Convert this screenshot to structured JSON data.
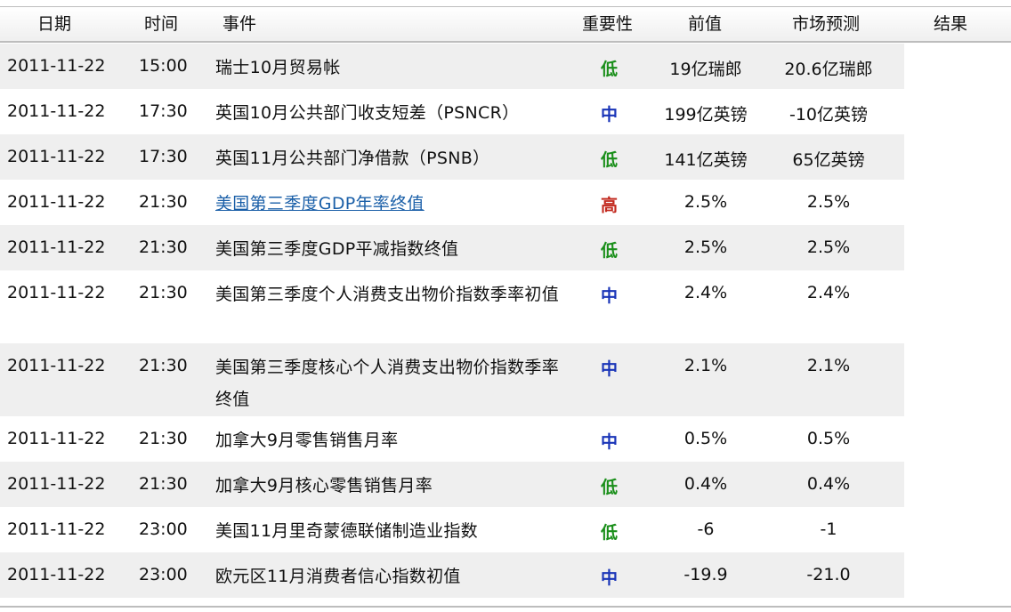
{
  "headers": {
    "date": "日期",
    "time": "时间",
    "event": "事件",
    "importance": "重要性",
    "previous": "前值",
    "forecast": "市场预测",
    "result": "结果"
  },
  "colors": {
    "low": "#1a8f1a",
    "medium": "#1a35b8",
    "high": "#c2281d",
    "link": "#1a5fa8"
  },
  "rows": [
    {
      "date": "2011-11-22",
      "time": "15:00",
      "event": "瑞士10月贸易帐",
      "importance": "低",
      "level": "low",
      "previous": "19亿瑞郎",
      "forecast": "20.6亿瑞郎",
      "link": false,
      "lines": 1
    },
    {
      "date": "2011-11-22",
      "time": "17:30",
      "event": "英国10月公共部门收支短差（PSNCR）",
      "importance": "中",
      "level": "mid",
      "previous": "199亿英镑",
      "forecast": "-10亿英镑",
      "link": false,
      "lines": 1
    },
    {
      "date": "2011-11-22",
      "time": "17:30",
      "event": "英国11月公共部门净借款（PSNB）",
      "importance": "低",
      "level": "low",
      "previous": "141亿英镑",
      "forecast": "65亿英镑",
      "link": false,
      "lines": 1
    },
    {
      "date": "2011-11-22",
      "time": "21:30",
      "event": "美国第三季度GDP年率终值",
      "importance": "高",
      "level": "high",
      "previous": "2.5%",
      "forecast": "2.5%",
      "link": true,
      "lines": 1
    },
    {
      "date": "2011-11-22",
      "time": "21:30",
      "event": "美国第三季度GDP平减指数终值",
      "importance": "低",
      "level": "low",
      "previous": "2.5%",
      "forecast": "2.5%",
      "link": false,
      "lines": 1
    },
    {
      "date": "2011-11-22",
      "time": "21:30",
      "event": "美国第三季度个人消费支出物价指数季率初值",
      "importance": "中",
      "level": "mid",
      "previous": "2.4%",
      "forecast": "2.4%",
      "link": false,
      "lines": 2
    },
    {
      "date": "2011-11-22",
      "time": "21:30",
      "event": "美国第三季度核心个人消费支出物价指数季率终值",
      "importance": "中",
      "level": "mid",
      "previous": "2.1%",
      "forecast": "2.1%",
      "link": false,
      "lines": 2
    },
    {
      "date": "2011-11-22",
      "time": "21:30",
      "event": "加拿大9月零售销售月率",
      "importance": "中",
      "level": "mid",
      "previous": "0.5%",
      "forecast": "0.5%",
      "link": false,
      "lines": 1
    },
    {
      "date": "2011-11-22",
      "time": "21:30",
      "event": "加拿大9月核心零售销售月率",
      "importance": "低",
      "level": "low",
      "previous": "0.4%",
      "forecast": "0.4%",
      "link": false,
      "lines": 1
    },
    {
      "date": "2011-11-22",
      "time": "23:00",
      "event": "美国11月里奇蒙德联储制造业指数",
      "importance": "低",
      "level": "low",
      "previous": "-6",
      "forecast": "-1",
      "link": false,
      "lines": 1
    },
    {
      "date": "2011-11-22",
      "time": "23:00",
      "event": "欧元区11月消费者信心指数初值",
      "importance": "中",
      "level": "mid",
      "previous": "-19.9",
      "forecast": "-21.0",
      "link": false,
      "lines": 1
    }
  ]
}
